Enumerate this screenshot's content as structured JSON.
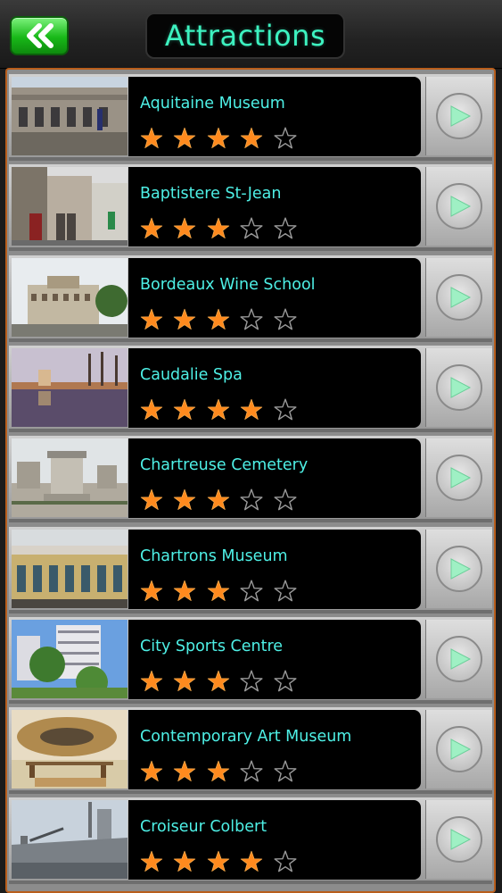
{
  "header": {
    "title": "Attractions",
    "back_icon": "double-chevron-left-icon",
    "back_color": "#18b818",
    "title_color": "#3df2c0"
  },
  "list": {
    "accent": "#b85e1c",
    "name_color": "#4ef0e6",
    "star_filled_color": "#ff8a1e",
    "max_rating": 5,
    "items": [
      {
        "name": "Aquitaine Museum",
        "rating": 4,
        "photo": "museum-facade-photo"
      },
      {
        "name": "Baptistere St-Jean",
        "rating": 3,
        "photo": "street-buildings-photo"
      },
      {
        "name": "Bordeaux Wine School",
        "rating": 3,
        "photo": "corner-building-photo"
      },
      {
        "name": "Caudalie Spa",
        "rating": 4,
        "photo": "lake-reflection-photo"
      },
      {
        "name": "Chartreuse Cemetery",
        "rating": 3,
        "photo": "cemetery-monument-photo"
      },
      {
        "name": "Chartrons Museum",
        "rating": 3,
        "photo": "hall-arcade-photo"
      },
      {
        "name": "City Sports Centre",
        "rating": 3,
        "photo": "apartments-trees-photo"
      },
      {
        "name": "Contemporary Art Museum",
        "rating": 3,
        "photo": "art-installation-photo"
      },
      {
        "name": "Croiseur Colbert",
        "rating": 4,
        "photo": "warship-photo"
      }
    ]
  }
}
